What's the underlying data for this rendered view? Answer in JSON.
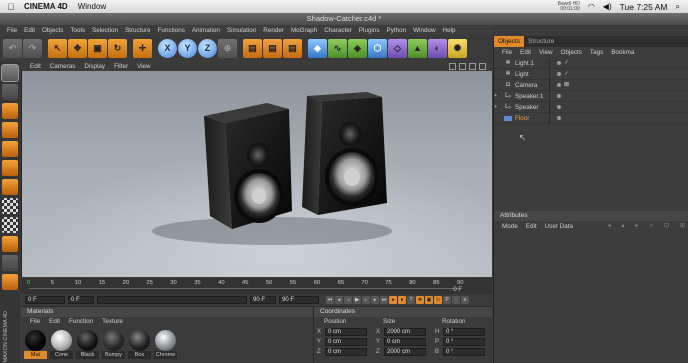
{
  "mac_menubar": {
    "app_name": "CINEMA 4D",
    "menu": "Window",
    "status_line1": "Bawdi HD",
    "status_line2": "00:01:00",
    "clock": "Tue 7:25 AM"
  },
  "window_title": "Shadow-Catcher.c4d *",
  "main_menu": [
    "File",
    "Edit",
    "Objects",
    "Tools",
    "Selection",
    "Structure",
    "Functions",
    "Animation",
    "Simulation",
    "Render",
    "MoGraph",
    "Character",
    "Plugins",
    "Python",
    "Window",
    "Help"
  ],
  "toolbar_axis_labels": [
    "X",
    "Y",
    "Z"
  ],
  "viewport": {
    "menu": [
      "Edit",
      "Cameras",
      "Display",
      "Filter",
      "View"
    ]
  },
  "timeline": {
    "ticks": [
      "0",
      "5",
      "10",
      "15",
      "20",
      "25",
      "30",
      "35",
      "40",
      "45",
      "50",
      "55",
      "60",
      "65",
      "70",
      "75",
      "80",
      "85",
      "90"
    ],
    "end_label": "0 F"
  },
  "transport": {
    "start_field": "0 F",
    "current_field": "0 F",
    "end_field": "90 F",
    "max_field": "90 F"
  },
  "materials": {
    "title": "Materials",
    "menu": [
      "File",
      "Edit",
      "Function",
      "Texture"
    ],
    "items": [
      {
        "label": "Mat",
        "color": "#050505"
      },
      {
        "label": "Cone",
        "color": "#d8d8d8"
      },
      {
        "label": "Black",
        "color": "#181818"
      },
      {
        "label": "Bumpy",
        "color": "#2a2a2a"
      },
      {
        "label": "Box",
        "color": "#222222"
      },
      {
        "label": "Chrome",
        "color": "#bfc4ca"
      }
    ]
  },
  "coordinates": {
    "title": "Coordinates",
    "columns": [
      "Position",
      "Size",
      "Rotation"
    ],
    "rows": [
      {
        "p_axis": "X",
        "p_val": "0 cm",
        "s_axis": "X",
        "s_val": "2000 cm",
        "r_axis": "H",
        "r_val": "0 °"
      },
      {
        "p_axis": "Y",
        "p_val": "0 cm",
        "s_axis": "Y",
        "s_val": "0 cm",
        "r_axis": "P",
        "r_val": "0 °"
      },
      {
        "p_axis": "Z",
        "p_val": "0 cm",
        "s_axis": "Z",
        "s_val": "2000 cm",
        "r_axis": "B",
        "r_val": "0 °"
      }
    ]
  },
  "objects_panel": {
    "tabs": [
      "Objects",
      "Structure"
    ],
    "menu": [
      "File",
      "Edit",
      "View",
      "Objects",
      "Tags",
      "Bookma"
    ],
    "items": [
      {
        "name": "Light.1",
        "icon": "light-icon",
        "tag": "✓"
      },
      {
        "name": "Light",
        "icon": "light-icon",
        "tag": "✓"
      },
      {
        "name": "Camera",
        "icon": "camera-icon",
        "tag": "⊠"
      },
      {
        "name": "Speaker.1",
        "icon": "null-object-icon",
        "tag": ""
      },
      {
        "name": "Speaker",
        "icon": "null-object-icon",
        "tag": ""
      },
      {
        "name": "Floor",
        "icon": "floor-icon",
        "tag": ""
      }
    ]
  },
  "attributes_panel": {
    "title": "Attributes",
    "menu": [
      "Mode",
      "Edit",
      "User Data"
    ]
  },
  "side_strip_label": "MAXON CINEMA 4D",
  "colors": {
    "accent_orange": "#e08a2a",
    "panel_bg": "#3b3b3b",
    "speaker_body": "#0d0d0d"
  }
}
